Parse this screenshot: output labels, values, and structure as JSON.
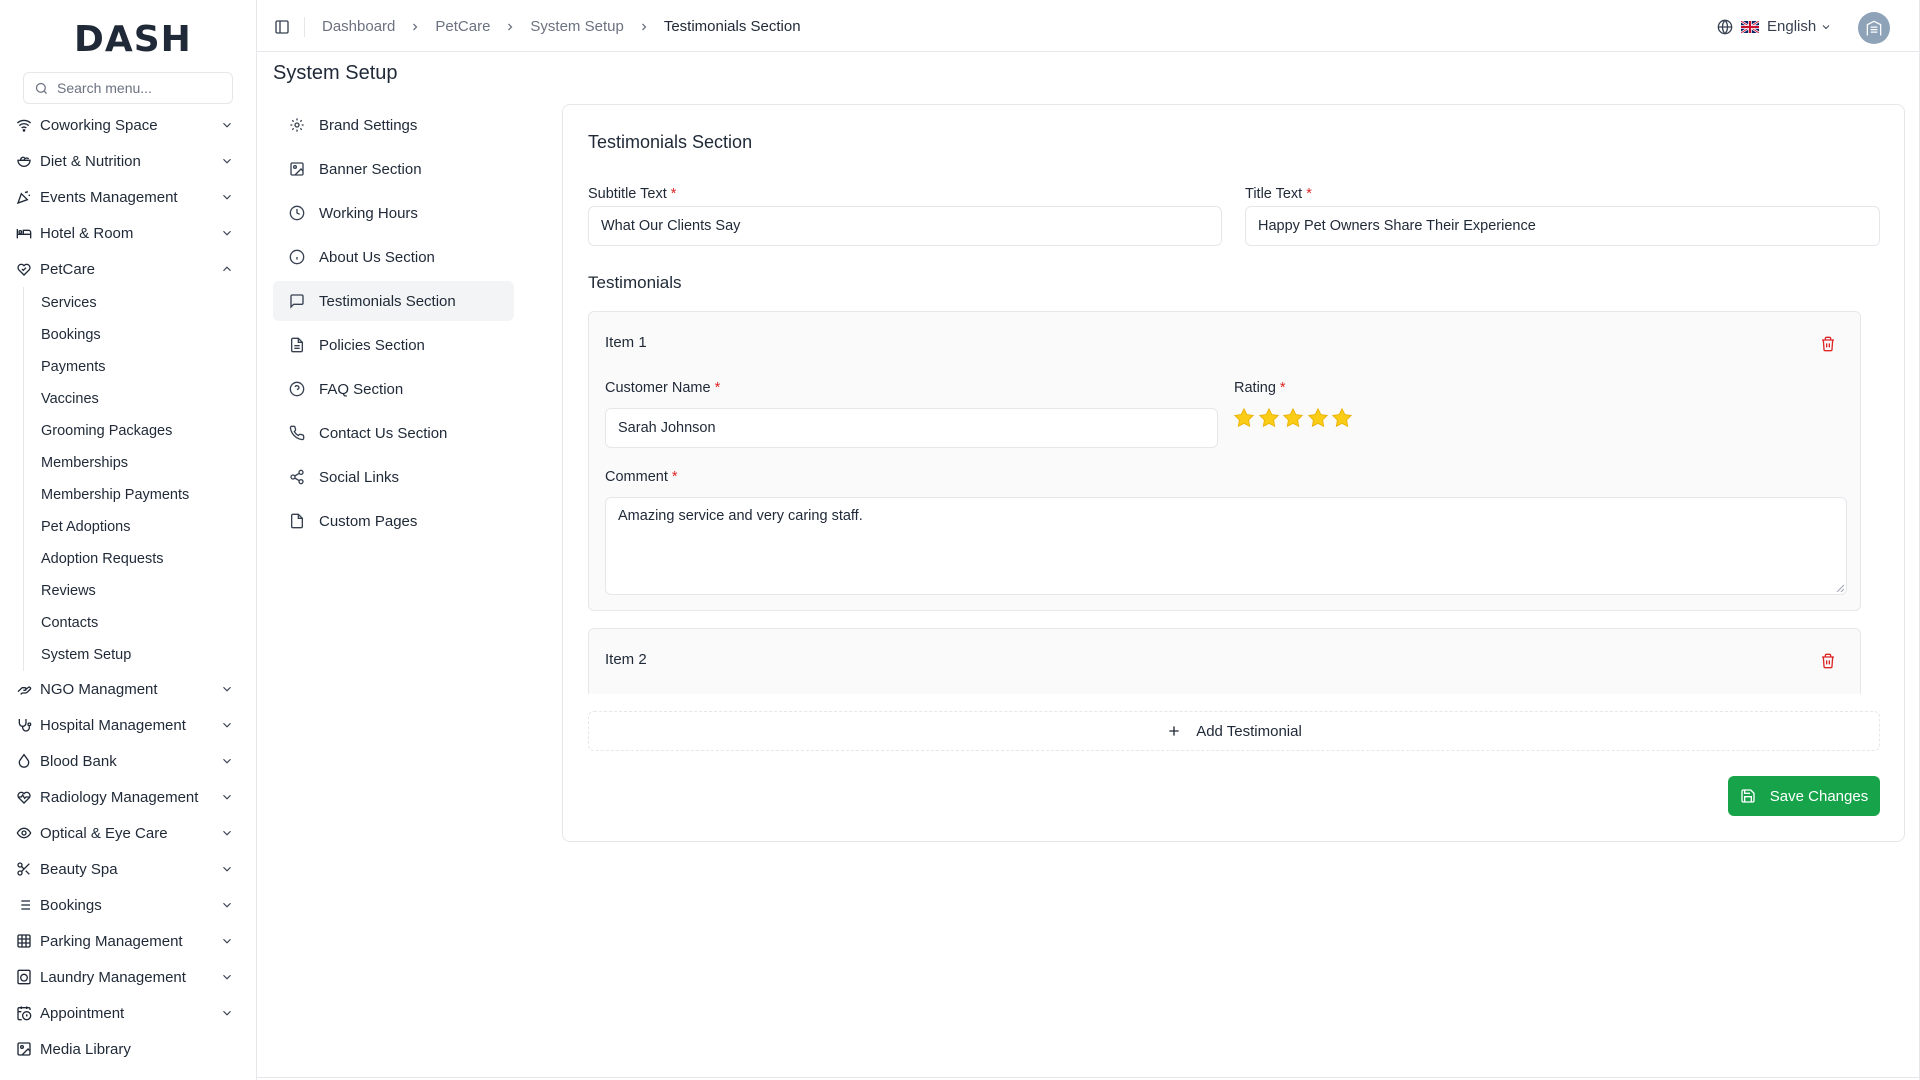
{
  "logo": {
    "text": "DASH"
  },
  "search": {
    "placeholder": "Search menu..."
  },
  "sidebar": {
    "top_items": [
      {
        "label": "Coworking Space",
        "icon": "wifi-icon"
      },
      {
        "label": "Diet & Nutrition",
        "icon": "salad-icon"
      },
      {
        "label": "Events Management",
        "icon": "party-icon"
      },
      {
        "label": "Hotel & Room",
        "icon": "bed-icon"
      },
      {
        "label": "PetCare",
        "icon": "paw-heart-icon"
      }
    ],
    "petcare_children": [
      "Services",
      "Bookings",
      "Payments",
      "Vaccines",
      "Grooming Packages",
      "Memberships",
      "Membership Payments",
      "Pet Adoptions",
      "Adoption Requests",
      "Reviews",
      "Contacts",
      "System Setup"
    ],
    "bottom_items": [
      {
        "label": "NGO Managment",
        "icon": "hand-heart-icon"
      },
      {
        "label": "Hospital Management",
        "icon": "stethoscope-icon"
      },
      {
        "label": "Blood Bank",
        "icon": "droplet-icon"
      },
      {
        "label": "Radiology Management",
        "icon": "heart-pulse-icon"
      },
      {
        "label": "Optical & Eye Care",
        "icon": "eye-icon"
      },
      {
        "label": "Beauty Spa",
        "icon": "scissors-icon"
      },
      {
        "label": "Bookings",
        "icon": "list-icon"
      },
      {
        "label": "Parking Management",
        "icon": "grid-icon"
      },
      {
        "label": "Laundry Management",
        "icon": "washer-icon"
      },
      {
        "label": "Appointment",
        "icon": "calendar-clock-icon"
      },
      {
        "label": "Media Library",
        "icon": "image-icon"
      }
    ]
  },
  "header": {
    "breadcrumb": [
      "Dashboard",
      "PetCare",
      "System Setup",
      "Testimonials Section"
    ],
    "language": "English"
  },
  "page": {
    "title": "System Setup"
  },
  "setup_menu": [
    {
      "label": "Brand Settings",
      "icon": "gear-icon"
    },
    {
      "label": "Banner Section",
      "icon": "image-icon"
    },
    {
      "label": "Working Hours",
      "icon": "clock-icon"
    },
    {
      "label": "About Us Section",
      "icon": "info-icon"
    },
    {
      "label": "Testimonials Section",
      "icon": "message-square-icon"
    },
    {
      "label": "Policies Section",
      "icon": "file-text-icon"
    },
    {
      "label": "FAQ Section",
      "icon": "help-circle-icon"
    },
    {
      "label": "Contact Us Section",
      "icon": "phone-icon"
    },
    {
      "label": "Social Links",
      "icon": "share-icon"
    },
    {
      "label": "Custom Pages",
      "icon": "file-icon"
    }
  ],
  "form": {
    "title": "Testimonials Section",
    "subtitle_label": "Subtitle Text",
    "subtitle_value": "What Our Clients Say",
    "title_label": "Title Text",
    "title_value": "Happy Pet Owners Share Their Experience",
    "testimonials_heading": "Testimonials",
    "required_mark": "*",
    "items": [
      {
        "title": "Item 1",
        "customer_label": "Customer Name",
        "customer_value": "Sarah Johnson",
        "rating_label": "Rating",
        "rating": 5,
        "comment_label": "Comment",
        "comment_value": "Amazing service and very caring staff."
      },
      {
        "title": "Item 2"
      }
    ],
    "add_label": "Add Testimonial",
    "save_label": "Save Changes"
  },
  "colors": {
    "primary": "#16a34a",
    "danger": "#dc2626",
    "star": "#facc15"
  }
}
